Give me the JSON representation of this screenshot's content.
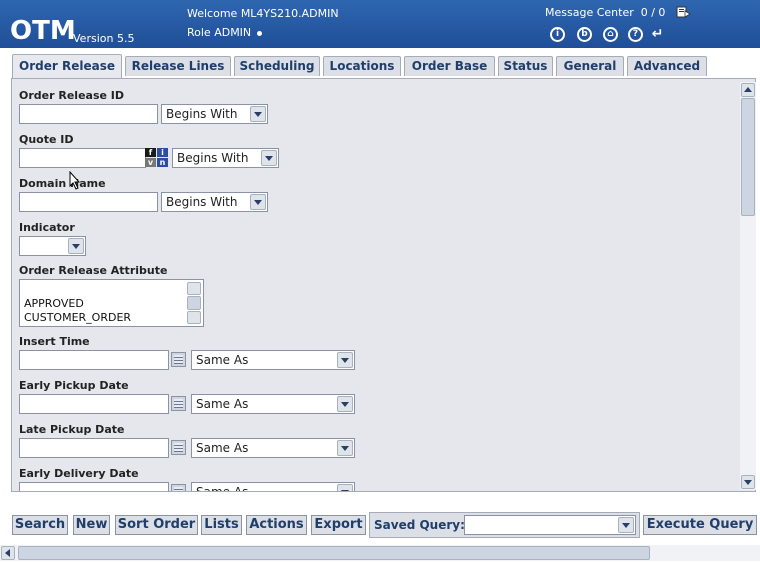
{
  "header": {
    "logo": "OTM",
    "version": "Version 5.5",
    "welcome": "Welcome ML4YS210.ADMIN",
    "role": "Role ADMIN",
    "message_center": "Message Center  0 / 0",
    "icons": [
      "info-icon",
      "bookmark-icon",
      "home-icon",
      "help-icon",
      "logout-icon"
    ],
    "icon_glyphs": [
      "i",
      "b",
      "⌂",
      "?",
      "↵"
    ]
  },
  "tabs": [
    {
      "label": "Order Release",
      "active": true
    },
    {
      "label": "Release Lines"
    },
    {
      "label": "Scheduling"
    },
    {
      "label": "Locations"
    },
    {
      "label": "Order Base"
    },
    {
      "label": "Status"
    },
    {
      "label": "General"
    },
    {
      "label": "Advanced"
    }
  ],
  "form": {
    "order_release_id": {
      "label": "Order Release ID",
      "value": "",
      "operator": "Begins With"
    },
    "quote_id": {
      "label": "Quote ID",
      "value": "",
      "operator": "Begins With"
    },
    "domain_name": {
      "label": "Domain Name",
      "value": "",
      "operator": "Begins With"
    },
    "indicator": {
      "label": "Indicator",
      "value": ""
    },
    "order_release_attribute": {
      "label": "Order Release Attribute",
      "options": [
        "APPROVED",
        "CUSTOMER_ORDER"
      ]
    },
    "insert_time": {
      "label": "Insert Time",
      "value": "",
      "operator": "Same As"
    },
    "early_pickup_date": {
      "label": "Early Pickup Date",
      "value": "",
      "operator": "Same As"
    },
    "late_pickup_date": {
      "label": "Late Pickup Date",
      "value": "",
      "operator": "Same As"
    },
    "early_delivery_date": {
      "label": "Early Delivery Date",
      "value": "",
      "operator": "Same As"
    }
  },
  "buttons": {
    "search": "Search",
    "new": "New",
    "sort_order": "Sort Order",
    "lists": "Lists",
    "actions": "Actions",
    "export": "Export",
    "saved_query_label": "Saved Query:",
    "saved_query_value": "",
    "execute_query": "Execute Query"
  },
  "colors": {
    "header_bg": "#2a5ca8",
    "panel_bg": "#e5e7ed",
    "tab_text": "#1f3e6b"
  }
}
